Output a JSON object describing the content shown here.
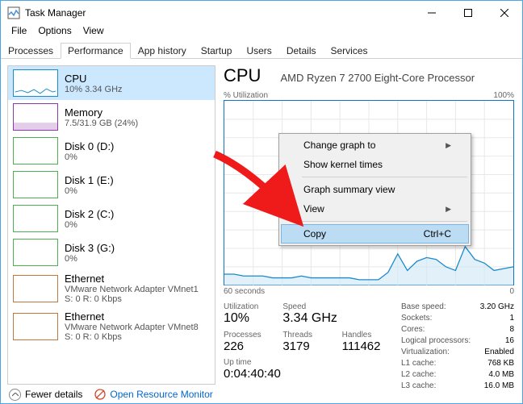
{
  "window": {
    "title": "Task Manager"
  },
  "menu": {
    "file": "File",
    "options": "Options",
    "view": "View"
  },
  "tabs": [
    "Processes",
    "Performance",
    "App history",
    "Startup",
    "Users",
    "Details",
    "Services"
  ],
  "sidebar": [
    {
      "name": "CPU",
      "detail": "10% 3.34 GHz",
      "color": "#1a8bcb"
    },
    {
      "name": "Memory",
      "detail": "7.5/31.9 GB (24%)",
      "color": "#8b3aa5"
    },
    {
      "name": "Disk 0 (D:)",
      "detail": "0%",
      "color": "#4caf50"
    },
    {
      "name": "Disk 1 (E:)",
      "detail": "0%",
      "color": "#4caf50"
    },
    {
      "name": "Disk 2 (C:)",
      "detail": "0%",
      "color": "#4caf50"
    },
    {
      "name": "Disk 3 (G:)",
      "detail": "0%",
      "color": "#4caf50"
    },
    {
      "name": "Ethernet",
      "detail": "VMware Network Adapter VMnet1",
      "detail2": "S: 0 R: 0 Kbps",
      "color": "#c0763f"
    },
    {
      "name": "Ethernet",
      "detail": "VMware Network Adapter VMnet8",
      "detail2": "S: 0 R: 0 Kbps",
      "color": "#c0763f"
    }
  ],
  "main": {
    "title": "CPU",
    "subtitle": "AMD Ryzen 7 2700 Eight-Core Processor",
    "graph": {
      "ylabel": "% Utilization",
      "ymax": "100%",
      "xlabel": "60 seconds",
      "xmin": "0"
    },
    "stats": {
      "utilization": {
        "label": "Utilization",
        "value": "10%"
      },
      "speed": {
        "label": "Speed",
        "value": "3.34 GHz"
      },
      "processes": {
        "label": "Processes",
        "value": "226"
      },
      "threads": {
        "label": "Threads",
        "value": "3179"
      },
      "handles": {
        "label": "Handles",
        "value": "111462"
      },
      "uptime": {
        "label": "Up time",
        "value": "0:04:40:40"
      }
    },
    "right": [
      {
        "k": "Base speed:",
        "v": "3.20 GHz"
      },
      {
        "k": "Sockets:",
        "v": "1"
      },
      {
        "k": "Cores:",
        "v": "8"
      },
      {
        "k": "Logical processors:",
        "v": "16"
      },
      {
        "k": "Virtualization:",
        "v": "Enabled"
      },
      {
        "k": "L1 cache:",
        "v": "768 KB"
      },
      {
        "k": "L2 cache:",
        "v": "4.0 MB"
      },
      {
        "k": "L3 cache:",
        "v": "16.0 MB"
      }
    ]
  },
  "context": {
    "items": [
      {
        "label": "Change graph to",
        "submenu": true
      },
      {
        "label": "Show kernel times"
      },
      {
        "sep": true
      },
      {
        "label": "Graph summary view"
      },
      {
        "label": "View",
        "submenu": true
      },
      {
        "sep": true
      },
      {
        "label": "Copy",
        "accel": "Ctrl+C",
        "hov": true
      }
    ]
  },
  "footer": {
    "fewer": "Fewer details",
    "orm": "Open Resource Monitor"
  },
  "chart_data": {
    "type": "line",
    "title": "% Utilization",
    "xlabel": "60 seconds",
    "ylabel": "%",
    "ylim": [
      0,
      100
    ],
    "x": [
      0,
      2,
      4,
      6,
      8,
      10,
      12,
      14,
      16,
      18,
      20,
      22,
      24,
      26,
      28,
      30,
      32,
      34,
      36,
      38,
      40,
      42,
      44,
      46,
      48,
      50,
      52,
      54,
      56,
      58,
      60
    ],
    "values": [
      6,
      6,
      5,
      5,
      5,
      4,
      4,
      4,
      5,
      4,
      4,
      4,
      4,
      4,
      3,
      3,
      3,
      7,
      17,
      8,
      13,
      15,
      14,
      10,
      8,
      21,
      14,
      12,
      8,
      9,
      10
    ]
  }
}
